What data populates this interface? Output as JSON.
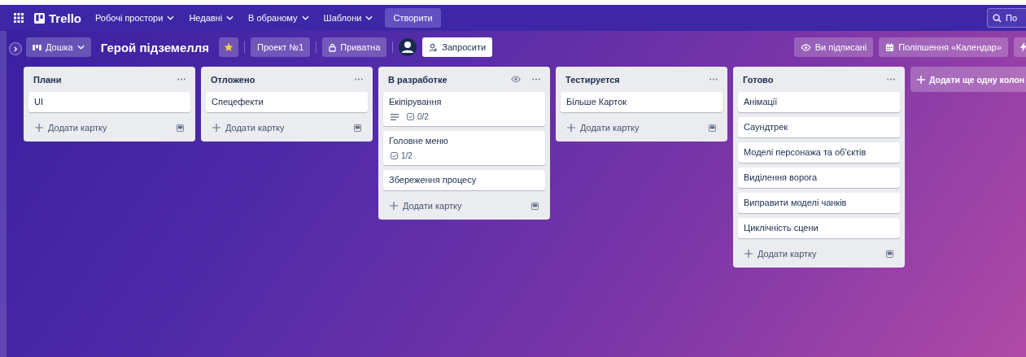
{
  "top_nav": {
    "logo": "Trello",
    "menus": [
      {
        "label": "Робочі простори"
      },
      {
        "label": "Недавні"
      },
      {
        "label": "В обраному"
      },
      {
        "label": "Шаблони"
      }
    ],
    "create_button": "Створити",
    "search": {
      "placeholder": "По"
    }
  },
  "board_bar": {
    "view_switch": "Дошка",
    "title": "Герой підземелля",
    "starred": true,
    "workspace": "Проект №1",
    "visibility": "Приватна",
    "invite": "Запросити",
    "watching": "Ви підписані",
    "power_up": "Поліпшення «Календар»"
  },
  "lists": [
    {
      "title": "Плани",
      "watched": false,
      "cards": [
        {
          "title": "UI",
          "description": false
        }
      ],
      "add_card": "Додати картку"
    },
    {
      "title": "Отложено",
      "watched": false,
      "cards": [
        {
          "title": "Спецефекти",
          "description": false
        }
      ],
      "add_card": "Додати картку"
    },
    {
      "title": "В разработке",
      "watched": true,
      "cards": [
        {
          "title": "Екіпірування",
          "description": true,
          "checklist": "0/2"
        },
        {
          "title": "Головне меню",
          "description": false,
          "checklist": "1/2"
        },
        {
          "title": "Збереження процесу",
          "description": false
        }
      ],
      "add_card": "Додати картку"
    },
    {
      "title": "Тестируется",
      "watched": false,
      "cards": [
        {
          "title": "Більше Карток",
          "description": false
        }
      ],
      "add_card": "Додати картку"
    },
    {
      "title": "Готово",
      "watched": false,
      "cards": [
        {
          "title": "Анімації",
          "description": false
        },
        {
          "title": "Саундтрек",
          "description": false
        },
        {
          "title": "Моделі персонажа та об'єктів",
          "description": false
        },
        {
          "title": "Виділення ворога",
          "description": false
        },
        {
          "title": "Виправити моделі чанків",
          "description": false
        },
        {
          "title": "Циклічність сцени",
          "description": false
        }
      ],
      "add_card": "Додати картку"
    }
  ],
  "add_list": "Додати ще одну колон"
}
